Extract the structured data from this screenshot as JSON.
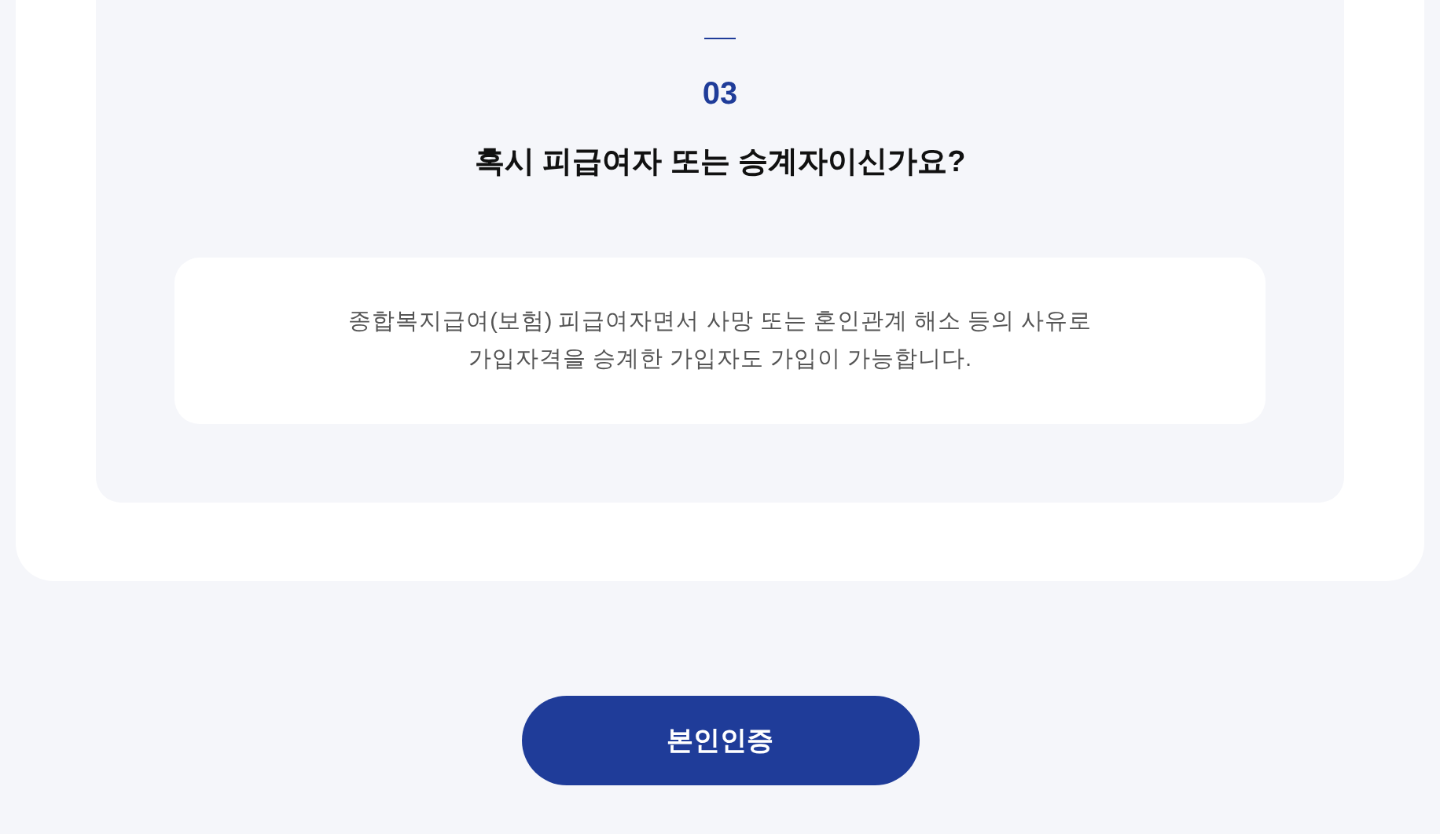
{
  "faq_item": {
    "number": "03",
    "question": "혹시 피급여자 또는 승계자이신가요?",
    "answer": "종합복지급여(보험) 피급여자면서 사망 또는 혼인관계 해소 등의 사유로\n가입자격을 승계한 가입자도 가입이 가능합니다."
  },
  "verify_button": {
    "label": "본인인증"
  }
}
